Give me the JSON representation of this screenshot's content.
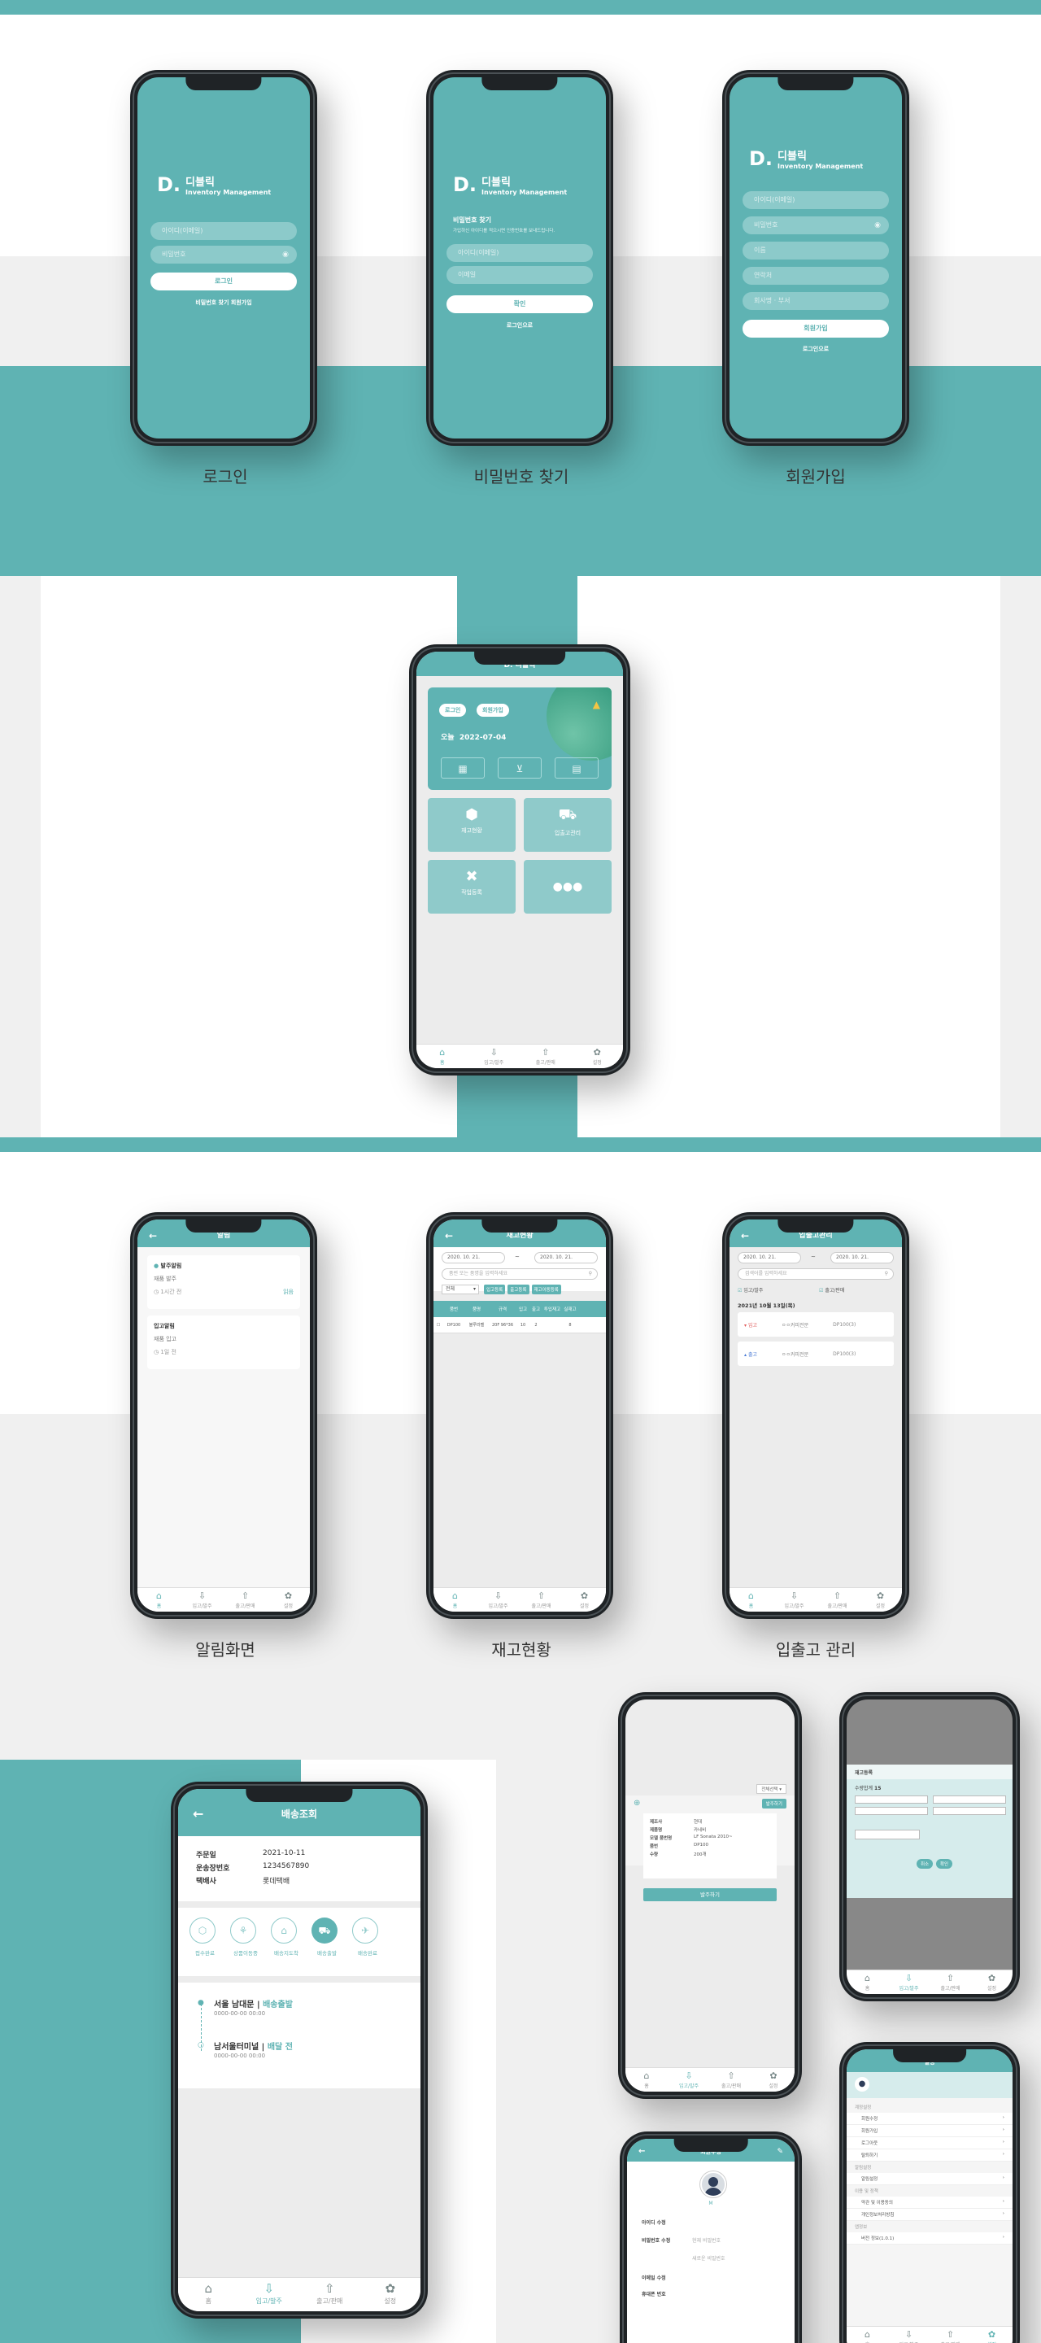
{
  "brand": {
    "mark": "D.",
    "name": "디블릭",
    "subtitle": "Inventory Management"
  },
  "captions": {
    "login": "로그인",
    "find_password": "비밀번호 찾기",
    "signup": "회원가입",
    "alerts": "알림화면",
    "stock": "재고현황",
    "inout": "입출고 관리"
  },
  "login": {
    "id_placeholder": "아이디(이메일)",
    "pw_placeholder": "비밀번호",
    "login_button": "로그인",
    "links": "비밀번호 찾기  회원가입"
  },
  "find_password": {
    "title": "비밀번호 찾기",
    "desc": "가입하신 아이디를 적으시면 인증번호를 보내드립니다.",
    "id_placeholder": "아이디(이메일)",
    "name_placeholder": "이메일",
    "confirm_button": "확인",
    "back_link": "로그인으로"
  },
  "signup": {
    "fields": [
      "아이디(이메일)",
      "비밀번호",
      "이름",
      "연락처",
      "회사명 · 부서"
    ],
    "submit_button": "회원가입",
    "back_link": "로그인으로"
  },
  "home": {
    "header": "디블릭",
    "chip_login": "로그인",
    "chip_signup": "회원가입",
    "today_label": "오늘",
    "today_date": "2022-07-04",
    "menus": [
      "재고현황",
      "입출고관리",
      "작업등록",
      ""
    ],
    "tabs": [
      "홈",
      "입고/발주",
      "출고/판매",
      "설정"
    ]
  },
  "alerts": {
    "header": "알림",
    "items": [
      {
        "title": "발주알림",
        "body": "재품 발주",
        "time": "1시간 전",
        "tag": "읽음"
      },
      {
        "title": "입고알림",
        "body": "재품 입고",
        "time": "1일 전",
        "tag": ""
      }
    ]
  },
  "stock": {
    "header": "재고현황",
    "date_from": "2020. 10. 21.",
    "date_to": "2020. 10. 21.",
    "search_placeholder": "품번 또는 품명을 입력하세요",
    "select": "전체",
    "filters": [
      "입고등록",
      "출고등록",
      "재고이동등록"
    ],
    "columns": [
      "",
      "품번",
      "품명",
      "규격",
      "입고",
      "출고",
      "투입재고",
      "실재고"
    ],
    "row": [
      "",
      "DP100",
      "블루라벨",
      "20F 96*36",
      "10",
      "2",
      "",
      "8"
    ]
  },
  "inout": {
    "header": "입출고관리",
    "date_from": "2020. 10. 21.",
    "date_to": "2020. 10. 21.",
    "search_placeholder": "검색어를 입력하세요",
    "check_in": "입고/발주",
    "check_out": "출고/판매",
    "date_label": "2021년 10월 13일(목)",
    "records": [
      {
        "type": "입고",
        "who": "ㅇㅇ커피전문",
        "code": "DP100(3)"
      },
      {
        "type": "출고",
        "who": "ㅇㅇ커피전문",
        "code": "DP100(3)"
      }
    ]
  },
  "delivery": {
    "header": "배송조회",
    "rows": [
      {
        "label": "주문일",
        "value": "2021-10-11"
      },
      {
        "label": "운송장번호",
        "value": "1234567890"
      },
      {
        "label": "택배사",
        "value": "롯데택배"
      }
    ],
    "steps": [
      "접수완료",
      "상품이동중",
      "배송지도착",
      "배송출발",
      "배송완료"
    ],
    "timeline": [
      {
        "place": "서울 남대문",
        "status": "배송출발",
        "time": "0000-00-00 00:00"
      },
      {
        "place": "남서울터미널",
        "status": "배달 전",
        "time": "0000-00-00 00:00"
      }
    ],
    "tabs": [
      "홈",
      "입고/발주",
      "출고/판매",
      "설정"
    ]
  },
  "order": {
    "select": "전체선택",
    "button_small": "발주하기",
    "rows": [
      {
        "label": "제조사",
        "value": "현대"
      },
      {
        "label": "제품명",
        "value": "카네비"
      },
      {
        "label": "모델 품번명",
        "value": "LF Sonata 2010~"
      },
      {
        "label": "품번",
        "value": "DP100"
      },
      {
        "label": "수량",
        "value": "200개"
      }
    ],
    "submit": "발주하기"
  },
  "profile": {
    "header": "회원수정",
    "name_initial": "M",
    "fields": [
      {
        "label": "아이디 수정",
        "value": ""
      },
      {
        "label": "비밀번호 수정",
        "value": "현재 비밀번호"
      },
      {
        "label": "",
        "value": "새로운 비밀번호"
      },
      {
        "label": "이메일 수정",
        "value": ""
      },
      {
        "label": "휴대폰 번호",
        "value": ""
      }
    ]
  },
  "settings": {
    "header": "설정",
    "sections": [
      {
        "title": "계정설정",
        "items": [
          "회원수정",
          "회원가입",
          "로그아웃",
          "탈퇴하기"
        ]
      },
      {
        "title": "알림설정",
        "items": [
          "알림설정"
        ]
      },
      {
        "title": "이용 및 정책",
        "items": [
          "약관 및 이용동의",
          "개인정보처리방침"
        ]
      },
      {
        "title": "앱정보",
        "items": [
          "버전 정보(1.0.1)"
        ]
      }
    ]
  },
  "count": {
    "header": "재고등록",
    "total_label": "수량합계",
    "total_value": "15",
    "buttons": [
      "취소",
      "확인"
    ]
  }
}
